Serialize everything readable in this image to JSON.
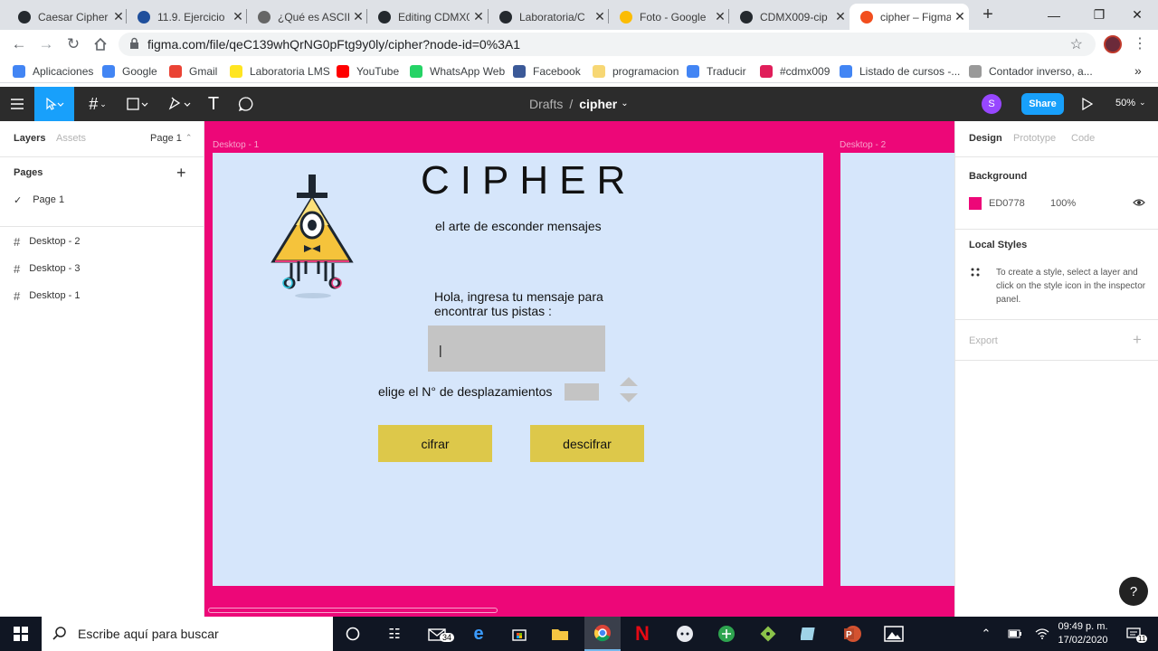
{
  "browser": {
    "tabs": [
      {
        "title": "Caesar Cipher",
        "icon": "github-icon",
        "color": "#24292e"
      },
      {
        "title": "11.9. Ejercicio",
        "icon": "diamond-icon",
        "color": "#1f4f9c"
      },
      {
        "title": "¿Qué es ASCII",
        "icon": "hat-icon",
        "color": "#666666"
      },
      {
        "title": "Editing CDMX0",
        "icon": "github-icon",
        "color": "#24292e"
      },
      {
        "title": "Laboratoria/C",
        "icon": "github-icon",
        "color": "#24292e"
      },
      {
        "title": "Foto - Google",
        "icon": "photos-icon",
        "color": "#fbbc04"
      },
      {
        "title": "CDMX009-cip",
        "icon": "github-icon",
        "color": "#24292e"
      },
      {
        "title": "cipher – Figma",
        "icon": "figma-icon",
        "color": "#f24e1e"
      }
    ],
    "tab_close": "✕",
    "new_tab": "+",
    "window": {
      "minimize": "—",
      "maximize": "❐",
      "close": "✕"
    },
    "url": "figma.com/file/qeC139whQrNG0pFtg9y0ly/cipher?node-id=0%3A1",
    "bookmarks": [
      {
        "label": "Aplicaciones",
        "color": "#4285f4"
      },
      {
        "label": "Google",
        "color": "#4285f4"
      },
      {
        "label": "Gmail",
        "color": "#ea4335"
      },
      {
        "label": "Laboratoria LMS",
        "color": "#ffe521"
      },
      {
        "label": "YouTube",
        "color": "#ff0000"
      },
      {
        "label": "WhatsApp Web",
        "color": "#25d366"
      },
      {
        "label": "Facebook",
        "color": "#3b5998"
      },
      {
        "label": "programacion",
        "color": "#f7d774"
      },
      {
        "label": "Traducir",
        "color": "#4285f4"
      },
      {
        "label": "#cdmx009",
        "color": "#e01e5a"
      },
      {
        "label": "Listado de cursos -...",
        "color": "#4285f4"
      },
      {
        "label": "Contador inverso, a...",
        "color": "#999999"
      }
    ],
    "more_bookmarks": "»"
  },
  "figma": {
    "breadcrumb_drafts": "Drafts",
    "breadcrumb_sep": "/",
    "file_name": "cipher",
    "avatar": "S",
    "share_label": "Share",
    "zoom": "50%",
    "left": {
      "tab_layers": "Layers",
      "tab_assets": "Assets",
      "page_selector": "Page 1",
      "pages_title": "Pages",
      "pages": [
        "Page 1"
      ],
      "layers": [
        "Desktop - 2",
        "Desktop - 3",
        "Desktop - 1"
      ]
    },
    "canvas": {
      "frame1_label": "Desktop - 1",
      "frame2_label": "Desktop - 2",
      "title": "CIPHER",
      "subtitle": "el arte de esconder mensajes",
      "prompt": "Hola, ingresa tu mensaje para encontrar tus pistas :",
      "input_value": "|",
      "shift_label": "elige el N° de desplazamientos",
      "cipher_button": "cifrar",
      "decipher_button": "descifrar",
      "frame_bg": "#d6e6fb",
      "button_color": "#ddc84a"
    },
    "right": {
      "tab_design": "Design",
      "tab_prototype": "Prototype",
      "tab_code": "Code",
      "background_title": "Background",
      "bg_hex": "ED0778",
      "bg_color": "#ed0778",
      "bg_opacity": "100%",
      "local_styles_title": "Local Styles",
      "local_styles_hint": "To create a style, select a layer and click on the style icon in the inspector panel.",
      "export_title": "Export",
      "help": "?"
    }
  },
  "taskbar": {
    "search_placeholder": "Escribe aquí para buscar",
    "badge": "34",
    "time": "09:49 p. m.",
    "date": "17/02/2020",
    "notif_count": "11"
  }
}
